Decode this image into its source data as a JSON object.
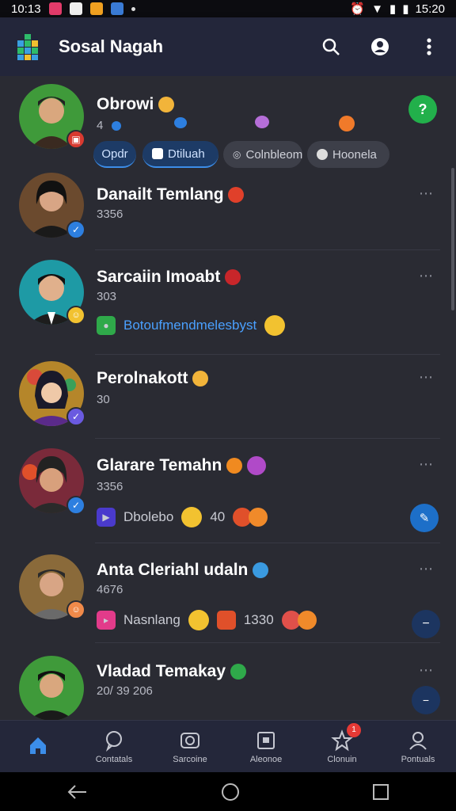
{
  "status_bar": {
    "time_left": "10:13",
    "time_right": "15:20"
  },
  "app": {
    "title": "Sosal Nagah"
  },
  "chats": [
    {
      "name": "Obrowi",
      "sub": "4",
      "chips": [
        "Opdr",
        "Dtiluah",
        "Colnbleom",
        "Hoonela"
      ]
    },
    {
      "name": "Danailt Temlang",
      "sub": "3356"
    },
    {
      "name": "Sarcaiin Imoabt",
      "sub": "303",
      "message": "Botoufmendmelesbyst"
    },
    {
      "name": "Perolnakott",
      "sub": "30"
    },
    {
      "name": "Glarare Temahn",
      "sub": "3356",
      "message": "Dbolebo",
      "count": "40"
    },
    {
      "name": "Anta Cleriahl udaln",
      "sub": "4676",
      "message": "Nasnlang",
      "count": "1330"
    },
    {
      "name": "Vladad Temakay",
      "sub": "20/ 39 206"
    }
  ],
  "bottom_nav": [
    {
      "label": "",
      "icon": "home-icon"
    },
    {
      "label": "Contatals",
      "icon": "chat-bubble-icon"
    },
    {
      "label": "Sarcoine",
      "icon": "camera-icon"
    },
    {
      "label": "Aleonoe",
      "icon": "screen-icon"
    },
    {
      "label": "Clonuin",
      "icon": "star-icon",
      "badge": "1"
    },
    {
      "label": "Pontuals",
      "icon": "person-icon"
    }
  ],
  "colors": {
    "accent": "#3c8de8",
    "app_bar": "#23263a",
    "list_bg": "#2a2b33",
    "green": "#22b04b"
  }
}
